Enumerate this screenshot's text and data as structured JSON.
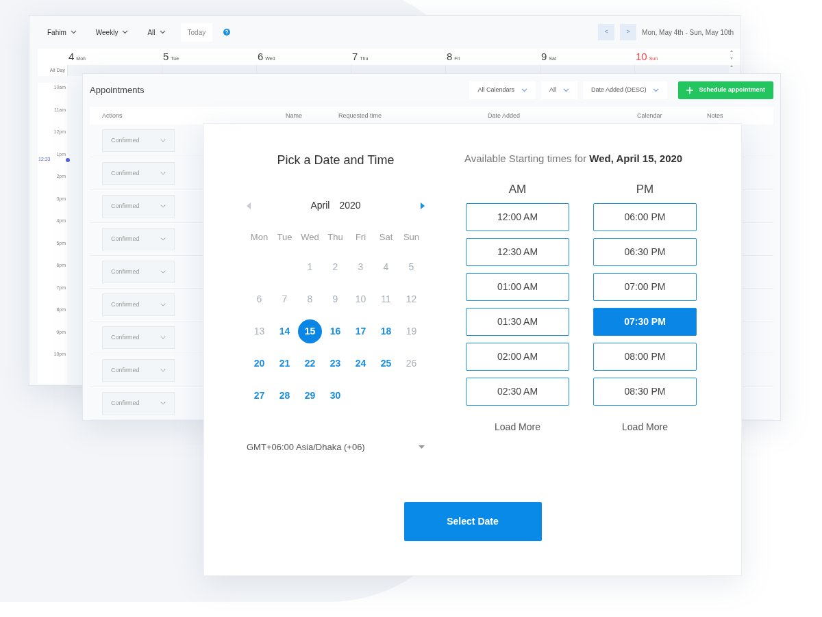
{
  "calendar_window": {
    "filters": [
      {
        "label": "Fahim"
      },
      {
        "label": "Weekly"
      },
      {
        "label": "All"
      }
    ],
    "today": "Today",
    "prev": "<",
    "next": ">",
    "range": "Mon, May 4th - Sun, May 10th",
    "days": [
      {
        "number": "4",
        "name": "Mon",
        "weekend": false
      },
      {
        "number": "5",
        "name": "Tue",
        "weekend": false
      },
      {
        "number": "6",
        "name": "Wed",
        "weekend": false
      },
      {
        "number": "7",
        "name": "Thu",
        "weekend": false
      },
      {
        "number": "8",
        "name": "Fri",
        "weekend": false
      },
      {
        "number": "9",
        "name": "Sat",
        "weekend": false
      },
      {
        "number": "10",
        "name": "Sun",
        "weekend": true
      }
    ],
    "all_day": "All Day",
    "hours": [
      "10am",
      "11am",
      "12pm",
      "1pm",
      "2pm",
      "3pm",
      "4pm",
      "5pm",
      "6pm",
      "7pm",
      "8pm",
      "9pm",
      "10pm"
    ],
    "now_time": "12:33"
  },
  "appointments": {
    "title": "Appointments",
    "filters": [
      "All Calendars",
      "All",
      "Date Added (DESC)"
    ],
    "add_button": "Schedule appointment",
    "columns": [
      "Actions",
      "Name",
      "Requested time",
      "Date Added",
      "Calendar",
      "Notes"
    ],
    "rows": [
      {
        "status": "Confirmed"
      },
      {
        "status": "Confirmed"
      },
      {
        "status": "Confirmed"
      },
      {
        "status": "Confirmed"
      },
      {
        "status": "Confirmed"
      },
      {
        "status": "Confirmed"
      },
      {
        "status": "Confirmed"
      },
      {
        "status": "Confirmed"
      },
      {
        "status": "Confirmed"
      }
    ]
  },
  "booking": {
    "title": "Pick a Date and Time",
    "month": "April",
    "year": "2020",
    "weekdays": [
      "Mon",
      "Tue",
      "Wed",
      "Thu",
      "Fri",
      "Sat",
      "Sun"
    ],
    "weeks": [
      [
        {
          "kind": "blank"
        },
        {
          "kind": "blank"
        },
        {
          "kind": "day",
          "label": "1",
          "available": false,
          "selected": false
        },
        {
          "kind": "day",
          "label": "2",
          "available": false,
          "selected": false
        },
        {
          "kind": "day",
          "label": "3",
          "available": false,
          "selected": false
        },
        {
          "kind": "day",
          "label": "4",
          "available": false,
          "selected": false
        },
        {
          "kind": "day",
          "label": "5",
          "available": false,
          "selected": false
        }
      ],
      [
        {
          "kind": "day",
          "label": "6",
          "available": false,
          "selected": false
        },
        {
          "kind": "day",
          "label": "7",
          "available": false,
          "selected": false
        },
        {
          "kind": "day",
          "label": "8",
          "available": false,
          "selected": false
        },
        {
          "kind": "day",
          "label": "9",
          "available": false,
          "selected": false
        },
        {
          "kind": "day",
          "label": "10",
          "available": false,
          "selected": false
        },
        {
          "kind": "day",
          "label": "11",
          "available": false,
          "selected": false
        },
        {
          "kind": "day",
          "label": "12",
          "available": false,
          "selected": false
        }
      ],
      [
        {
          "kind": "day",
          "label": "13",
          "available": false,
          "selected": false
        },
        {
          "kind": "day",
          "label": "14",
          "available": true,
          "selected": false
        },
        {
          "kind": "day",
          "label": "15",
          "available": true,
          "selected": true
        },
        {
          "kind": "day",
          "label": "16",
          "available": true,
          "selected": false
        },
        {
          "kind": "day",
          "label": "17",
          "available": true,
          "selected": false
        },
        {
          "kind": "day",
          "label": "18",
          "available": true,
          "selected": false
        },
        {
          "kind": "day",
          "label": "19",
          "available": false,
          "selected": false
        }
      ],
      [
        {
          "kind": "day",
          "label": "20",
          "available": true,
          "selected": false
        },
        {
          "kind": "day",
          "label": "21",
          "available": true,
          "selected": false
        },
        {
          "kind": "day",
          "label": "22",
          "available": true,
          "selected": false
        },
        {
          "kind": "day",
          "label": "23",
          "available": true,
          "selected": false
        },
        {
          "kind": "day",
          "label": "24",
          "available": true,
          "selected": false
        },
        {
          "kind": "day",
          "label": "25",
          "available": true,
          "selected": false
        },
        {
          "kind": "day",
          "label": "26",
          "available": false,
          "selected": false
        }
      ],
      [
        {
          "kind": "day",
          "label": "27",
          "available": true,
          "selected": false
        },
        {
          "kind": "day",
          "label": "28",
          "available": true,
          "selected": false
        },
        {
          "kind": "day",
          "label": "29",
          "available": true,
          "selected": false
        },
        {
          "kind": "day",
          "label": "30",
          "available": true,
          "selected": false
        }
      ]
    ],
    "timezone": "GMT+06:00 Asia/Dhaka (+06)",
    "times_heading": "Available Starting times for **Wed, April 15, 2020**",
    "slot_columns": [
      {
        "heading": "AM",
        "load_more": "Load More",
        "slots": [
          {
            "label": "12:00 AM",
            "selected": false
          },
          {
            "label": "12:30 AM",
            "selected": false
          },
          {
            "label": "01:00 AM",
            "selected": false
          },
          {
            "label": "01:30 AM",
            "selected": false
          },
          {
            "label": "02:00 AM",
            "selected": false
          },
          {
            "label": "02:30 AM",
            "selected": false
          }
        ]
      },
      {
        "heading": "PM",
        "load_more": "Load More",
        "slots": [
          {
            "label": "06:00 PM",
            "selected": false
          },
          {
            "label": "06:30 PM",
            "selected": false
          },
          {
            "label": "07:00 PM",
            "selected": false
          },
          {
            "label": "07:30 PM",
            "selected": true
          },
          {
            "label": "08:00 PM",
            "selected": false
          },
          {
            "label": "08:30 PM",
            "selected": false
          }
        ]
      }
    ],
    "submit": "Select Date"
  }
}
